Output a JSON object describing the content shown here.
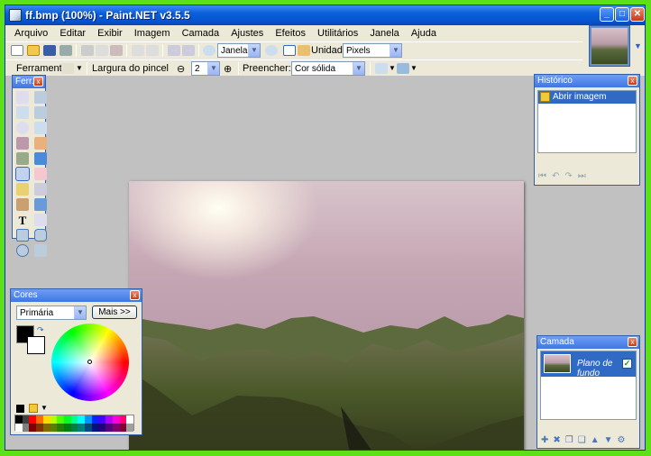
{
  "window": {
    "title": "ff.bmp (100%) - Paint.NET v3.5.5"
  },
  "menu": [
    "Arquivo",
    "Editar",
    "Exibir",
    "Imagem",
    "Camada",
    "Ajustes",
    "Efeitos",
    "Utilitários",
    "Janela",
    "Ajuda"
  ],
  "toolbar": {
    "zoom_value": "Janela",
    "units_label": "Unidades",
    "units_value": "Pixels",
    "tool_label": "Ferramenta:",
    "brush_width_label": "Largura do pincel",
    "brush_width_value": "2",
    "fill_label": "Preencher:",
    "fill_value": "Cor sólida"
  },
  "tools_panel": {
    "title": "Ferr..."
  },
  "history_panel": {
    "title": "Histórico",
    "items": [
      "Abrir imagem"
    ]
  },
  "colors_panel": {
    "title": "Cores",
    "mode_value": "Primária",
    "more_button": "Mais >>"
  },
  "layers_panel": {
    "title": "Camada",
    "layers": [
      {
        "name": "Plano de fundo",
        "visible": true
      }
    ]
  },
  "colors": {
    "accent": "#316ac5",
    "title_blue": "#0a5fd8",
    "desktop_green": "#5ee016"
  }
}
